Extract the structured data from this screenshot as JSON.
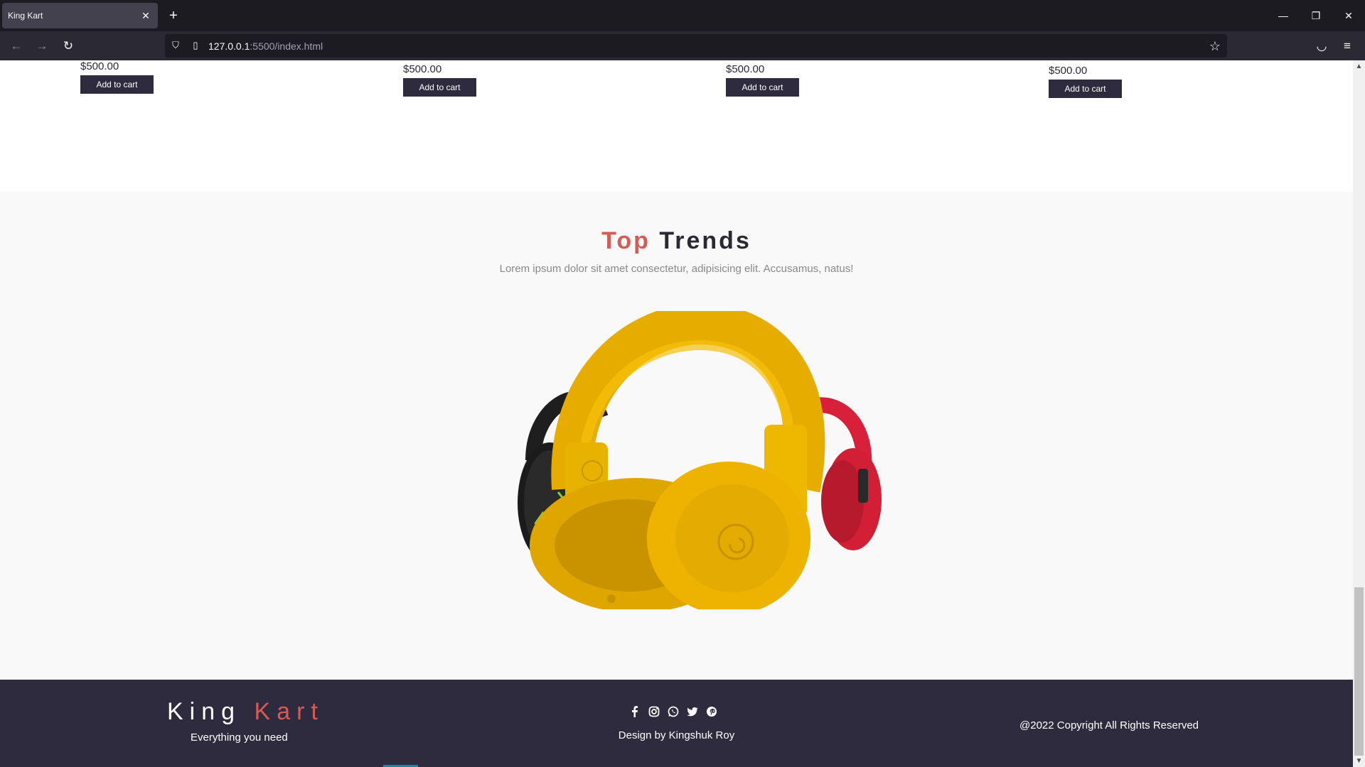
{
  "browser": {
    "tab_title": "King Kart",
    "url_host": "127.0.0.1",
    "url_path": ":5500/index.html"
  },
  "products": [
    {
      "price": "$500.00",
      "button": "Add to cart"
    },
    {
      "price": "$500.00",
      "button": "Add to cart"
    },
    {
      "price": "$500.00",
      "button": "Add to cart"
    },
    {
      "price": "$500.00",
      "button": "Add to cart"
    }
  ],
  "trends": {
    "title_accent": "Top",
    "title_rest": "Trends",
    "subtitle": "Lorem ipsum dolor sit amet consectetur, adipisicing elit. Accusamus, natus!",
    "carousel_active_index": 2,
    "carousel_count": 4
  },
  "footer": {
    "brand_first": "King",
    "brand_second": "Kart",
    "tagline": "Everything you need",
    "designer": "Design by Kingshuk Roy",
    "copyright": "@2022 Copyright All Rights Reserved",
    "socials": [
      "facebook-icon",
      "instagram-icon",
      "whatsapp-icon",
      "twitter-icon",
      "pinterest-icon"
    ]
  },
  "colors": {
    "accent": "#d65a55",
    "dark": "#2e2b3e",
    "active_dot": "#1877d2"
  }
}
